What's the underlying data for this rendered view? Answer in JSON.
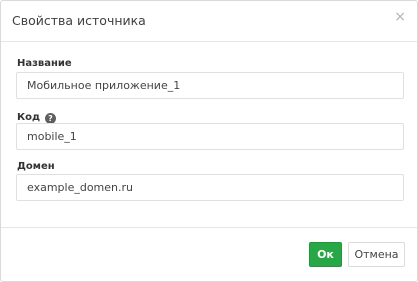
{
  "dialog": {
    "title": "Свойства источника",
    "close_glyph": "×"
  },
  "fields": {
    "name": {
      "label": "Название",
      "value": "Мобильное приложение_1"
    },
    "code": {
      "label": "Код",
      "value": "mobile_1",
      "help_glyph": "?"
    },
    "domain": {
      "label": "Домен",
      "value": "example_domen.ru"
    }
  },
  "footer": {
    "ok_label": "Ок",
    "cancel_label": "Отмена"
  },
  "colors": {
    "ok_button": "#27a745",
    "help_icon": "#5f5f5f"
  }
}
